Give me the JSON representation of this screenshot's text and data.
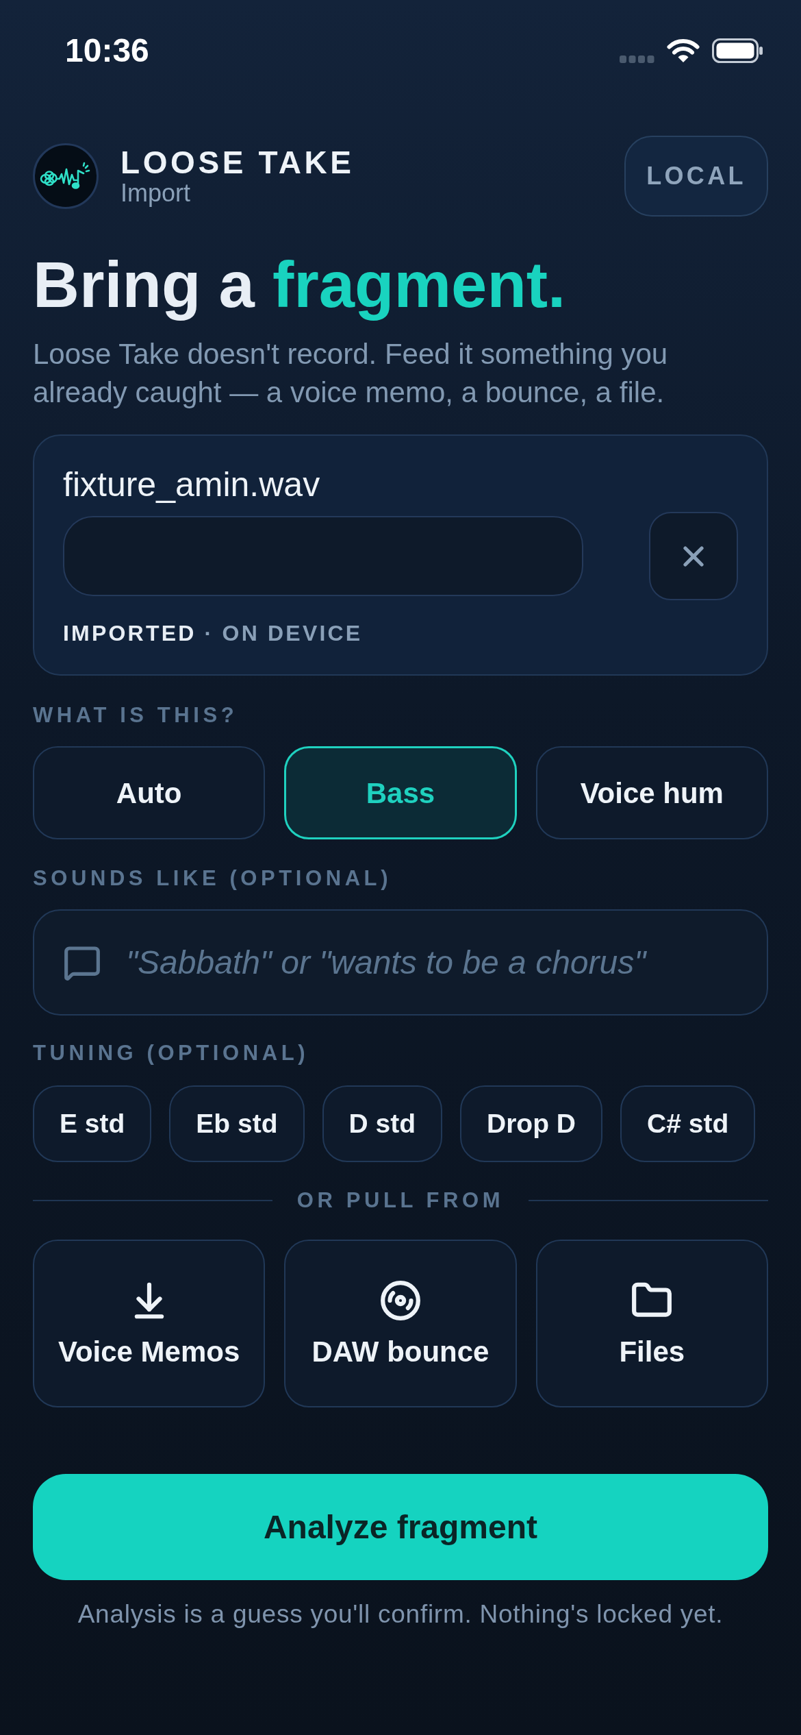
{
  "status_bar": {
    "time": "10:36"
  },
  "header": {
    "app_name": "LOOSE TAKE",
    "screen": "Import",
    "mode_button": "LOCAL"
  },
  "headline": {
    "text": "Bring a",
    "accent_text": "fragment."
  },
  "intro": "Loose Take doesn't record. Feed it something you already caught — a voice memo, a bounce, a file.",
  "file_card": {
    "file_name": "fixture_amin.wav",
    "status": "IMPORTED",
    "detail": "· ON DEVICE"
  },
  "type_picker": {
    "label": "WHAT IS THIS?",
    "options": [
      {
        "label": "Auto",
        "selected": false
      },
      {
        "label": "Bass",
        "selected": true
      },
      {
        "label": "Voice hum",
        "selected": false
      }
    ]
  },
  "sounds_like": {
    "label": "SOUNDS LIKE (OPTIONAL)",
    "placeholder": "\"Sabbath\" or \"wants to be a chorus\""
  },
  "tuning": {
    "label": "TUNING (OPTIONAL)",
    "options": [
      {
        "label": "E std",
        "selected": false
      },
      {
        "label": "Eb std",
        "selected": false
      },
      {
        "label": "D std",
        "selected": false
      },
      {
        "label": "Drop D",
        "selected": false
      },
      {
        "label": "C# std",
        "selected": false
      }
    ]
  },
  "sources": {
    "divider_label": "OR PULL FROM",
    "items": [
      {
        "kind": "download",
        "label": "Voice Memos"
      },
      {
        "kind": "disc",
        "label": "DAW bounce"
      },
      {
        "kind": "folder",
        "label": "Files"
      }
    ]
  },
  "analyze_button": "Analyze fragment",
  "footnote": "Analysis is a guess you'll confirm. Nothing's locked yet."
}
